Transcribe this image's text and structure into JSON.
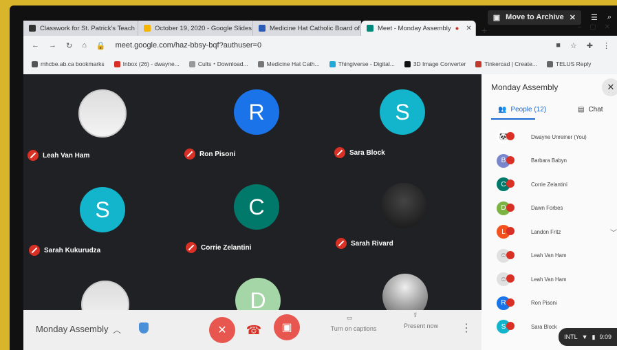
{
  "os": {
    "archive_label": "Move to Archive",
    "shelf": {
      "ime": "INTL",
      "time": "9:09"
    }
  },
  "tabs": [
    {
      "label": "Classwork for St. Patrick's Teach",
      "color": "#333333"
    },
    {
      "label": "October 19, 2020 - Google Slides",
      "color": "#f4b400"
    },
    {
      "label": "Medicine Hat Catholic Board of",
      "color": "#2b5db8"
    },
    {
      "label": "Meet - Monday Assembly",
      "color": "#00897b",
      "active": true
    }
  ],
  "address": {
    "url": "meet.google.com/haz-bbsy-bqf?authuser=0"
  },
  "bookmarks": [
    {
      "label": "mhcbe.ab.ca bookmarks",
      "color": "#555555"
    },
    {
      "label": "Inbox (26) - dwayne...",
      "color": "#d93025"
    },
    {
      "label": "Cults・Download...",
      "color": "#999999"
    },
    {
      "label": "Medicine Hat Cath...",
      "color": "#777777"
    },
    {
      "label": "Thingiverse - Digital...",
      "color": "#21a8d8"
    },
    {
      "label": "3D Image Converter",
      "color": "#111111"
    },
    {
      "label": "Tinkercad | Create...",
      "color": "#c0392b"
    },
    {
      "label": "TELUS Reply",
      "color": "#666666"
    }
  ],
  "participants_grid": [
    {
      "name": "Leah Van Ham",
      "initial": "",
      "avatar": "photo",
      "color": "#e0e0e0"
    },
    {
      "name": "Ron Pisoni",
      "initial": "R",
      "avatar": "letter",
      "color": "#1a73e8"
    },
    {
      "name": "Sara Block",
      "initial": "S",
      "avatar": "letter",
      "color": "#12b5cb"
    },
    {
      "name": "Sarah Kukurudza",
      "initial": "S",
      "avatar": "letter",
      "color": "#12b5cb"
    },
    {
      "name": "Corrie Zelantini",
      "initial": "C",
      "avatar": "letter",
      "color": "#00796b"
    },
    {
      "name": "Sarah Rivard",
      "initial": "",
      "avatar": "photo-dark",
      "color": "#222222"
    }
  ],
  "controls": {
    "meeting_title": "Monday Assembly",
    "captions_label": "Turn on captions",
    "present_label": "Present now"
  },
  "panel": {
    "title": "Monday Assembly",
    "tab_people": "People (12)",
    "tab_chat": "Chat",
    "people": [
      {
        "name": "Dwayne Unreiner (You)",
        "initial": "",
        "color": "#ffffff"
      },
      {
        "name": "Barbara Babyn",
        "initial": "B",
        "color": "#7986cb"
      },
      {
        "name": "Corrie Zelantini",
        "initial": "C",
        "color": "#00796b"
      },
      {
        "name": "Dawn Forbes",
        "initial": "D",
        "color": "#7cb342"
      },
      {
        "name": "Landon Fritz",
        "initial": "L",
        "color": "#f4511e"
      },
      {
        "name": "Leah Van Ham",
        "initial": "",
        "color": "#e0e0e0"
      },
      {
        "name": "Leah Van Ham",
        "initial": "",
        "color": "#e0e0e0"
      },
      {
        "name": "Ron Pisoni",
        "initial": "R",
        "color": "#1a73e8"
      },
      {
        "name": "Sara Block",
        "initial": "S",
        "color": "#12b5cb"
      }
    ]
  }
}
